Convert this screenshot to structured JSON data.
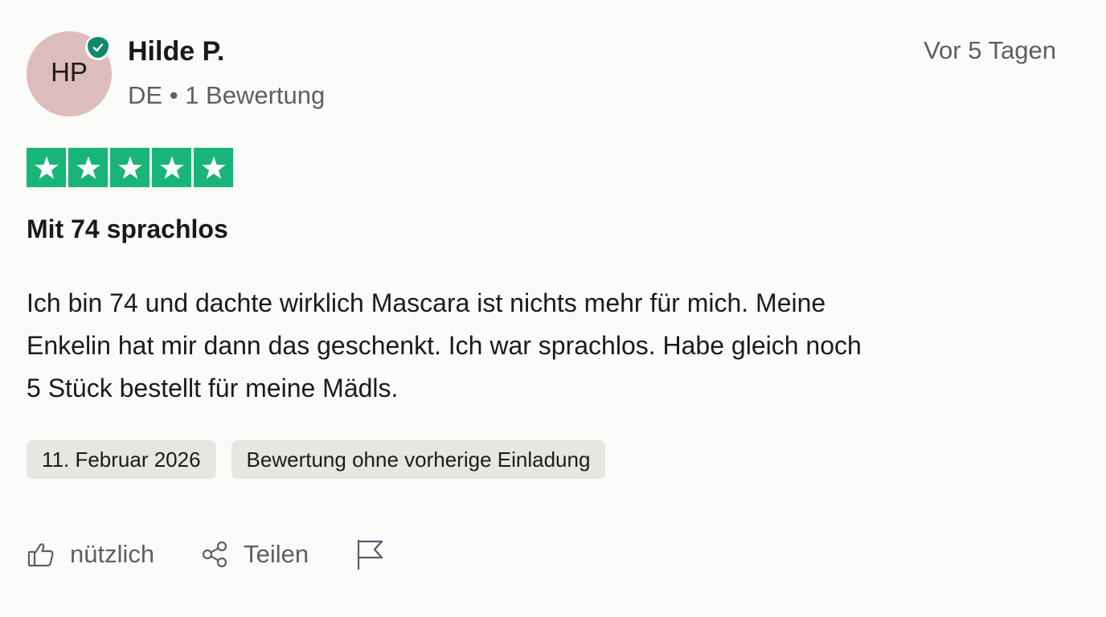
{
  "reviewer": {
    "initials": "HP",
    "name": "Hilde P.",
    "country": "DE",
    "separator": "•",
    "review_count": "1 Bewertung",
    "verified_icon": "verified-check-icon",
    "avatar_color": "#ddbcbc"
  },
  "review": {
    "relative_date": "Vor 5 Tagen",
    "rating": 5,
    "rating_max": 5,
    "star_color": "#19b47a",
    "title": "Mit 74 sprachlos",
    "body_lines": [
      "Ich bin 74 und dachte wirklich Mascara ist nichts mehr für mich. Meine",
      "Enkelin hat mir dann das geschenkt. Ich war sprachlos. Habe gleich noch",
      "5 Stück bestellt für meine Mädls."
    ],
    "tags": [
      "11. Februar 2026",
      "Bewertung ohne vorherige Einladung"
    ]
  },
  "actions": {
    "helpful_label": "nützlich",
    "helpful_icon": "thumbs-up-icon",
    "share_label": "Teilen",
    "share_icon": "share-icon",
    "report_icon": "flag-icon"
  }
}
